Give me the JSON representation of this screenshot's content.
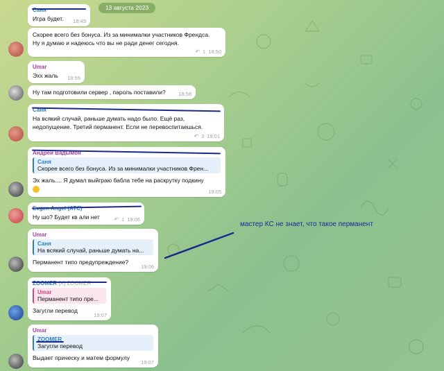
{
  "date": "13 августа 2023",
  "annotation": "мастер КС не знает, что такое перманент",
  "messages": [
    {
      "author": "Саня",
      "text": "Игра будет.",
      "time": "18:49"
    },
    {
      "text": "Скорее всего без бонуса. Из за минималки участников Френдса. Ну я думаю и надеюсь что вы не ради денег сегодня.",
      "replies": "1",
      "time": "18:50"
    },
    {
      "author": "Umar",
      "text": "Эхх жаль",
      "time": "18:55"
    },
    {
      "text": "Ну там подготовили сервер , пароль поставили?",
      "time": "18:58"
    },
    {
      "author": "Саня",
      "text": "На всякий случай, раньше думать надо было. Ещё раз, недопущение. Третий перманент. Если не перевоспитаешься.",
      "replies": "3",
      "time": "19:01"
    },
    {
      "author": "Андрей Вадымон",
      "quote_author": "Саня",
      "quote_text": "Скорее всего без бонуса. Из за минималки участников Френ...",
      "text": "Эх жаль.... Я думал выйграю бабла тебе на раскрутку подкину",
      "time": "19:05"
    },
    {
      "author": "Evgen Angel (ATC)",
      "text": "Ну шо? Будет кв али нет",
      "replies": "1",
      "time": "19:06"
    },
    {
      "author": "Umar",
      "quote_author": "Саня",
      "quote_text": "На всякий случай, раньше думать на...",
      "text": "Перманент типо предупреждение?",
      "time": "19:06"
    },
    {
      "author": "ZOOMER",
      "author_tag": "[X] ZOOMER",
      "quote_author": "Umar",
      "quote_text": "Перманент типо пре...",
      "text": "Загугли перевод",
      "time": "19:07"
    },
    {
      "author": "Umar",
      "quote_author": "ZOOMER",
      "quote_text": "Загугли перевод",
      "text": "Выдает прическу и матем формулу",
      "time": "19:07"
    }
  ]
}
